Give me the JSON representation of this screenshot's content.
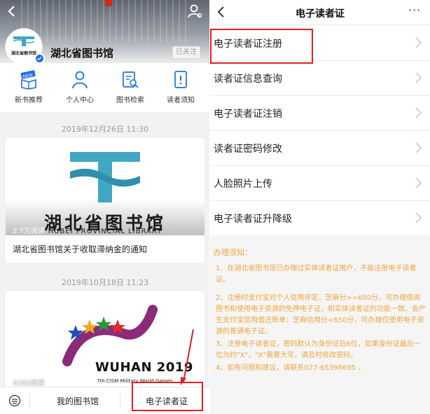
{
  "colors": {
    "notice_text": "#f0a63c",
    "highlight": "#e02020",
    "icon_blue": "#1f6fe5",
    "logo_teal": "#3fa7c2"
  },
  "left": {
    "library_name": "湖北省图书馆",
    "follow_badge": "已关注",
    "avatar_logo_text": "湖北省图书馆",
    "quick_actions": [
      {
        "label": "新书推荐",
        "icon": "new-book-icon",
        "badge": "NEW"
      },
      {
        "label": "个人中心",
        "icon": "person-icon"
      },
      {
        "label": "图书检索",
        "icon": "book-search-icon"
      },
      {
        "label": "读者须知",
        "icon": "notice-icon"
      }
    ],
    "article1": {
      "timestamp": "2019年12月26日 11:30",
      "image_title_cn": "湖北省图书馆",
      "image_title_en": "HUBEI PROVINCIAL LIBRARY",
      "views": "2.7万阅读",
      "caption": "湖北省图书馆关于收取滞纳金的通知"
    },
    "article2": {
      "timestamp": "2019年10月18日 11:23",
      "image_title": "WUHAN 2019",
      "image_subtitle": "7th CISM Military World Games",
      "views": "4262阅读"
    },
    "bottom_bar": {
      "item1": "我的图书馆",
      "item2": "电子读者证"
    }
  },
  "right": {
    "title": "电子读者证",
    "more": "···",
    "menu": [
      "电子读者证注册",
      "读者证信息查询",
      "电子读者证注销",
      "读者证密码修改",
      "人脸照片上传",
      "电子读者证升降级"
    ],
    "notice_title": "办理须知：",
    "notice_items": [
      "1、在湖北省图书馆已办理过实体读者证用户，不能注册电子读者证。",
      "2、注册时支付宝对个人信用评定，芝麻分>=650分，可办理借阅图书和使用电子资源的免押电子证，和实体读者证的功能一致。会产生支付宝信用借还账单；芝麻信用分<650分，可办理仅使用电子资源的普通电子证。",
      "3、注册电子读者证，密码默认为身份证后6位，如果身份证最后一位为约\"X\"，\"X\"需要大写，请及时修改密码。",
      "4、如有问题和建议，请联系027-65398695 。"
    ]
  }
}
